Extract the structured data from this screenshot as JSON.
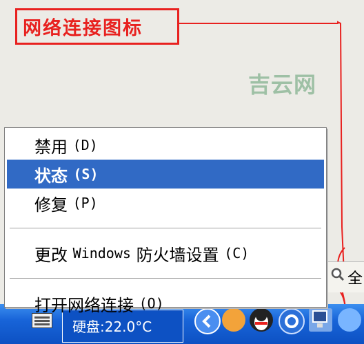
{
  "callout": {
    "label": "网络连接图标"
  },
  "watermark": "吉云网",
  "context_menu": {
    "items": [
      {
        "label": "禁用",
        "hotkey": "(D)"
      },
      {
        "label": "状态",
        "hotkey": "(S)"
      },
      {
        "label": "修复",
        "hotkey": "(P)"
      },
      {
        "label": "更改",
        "latin": "Windows",
        "label_suffix": "防火墙设置",
        "hotkey": "(C)"
      },
      {
        "label": "打开网络连接",
        "hotkey": "(O)"
      }
    ],
    "selected_index": 1
  },
  "taskbar": {
    "disk_status": "硬盘:22.0°C",
    "search_char": "全"
  },
  "colors": {
    "annotation_red": "#e8211f",
    "selection_blue": "#316ac5",
    "taskbar_blue": "#1864d8",
    "watermark_green": "#9ec0a5"
  },
  "icons": [
    "keyboard-icon",
    "back-arrow-icon",
    "qq-penguin-icon",
    "gear-icon",
    "network-connection-icon",
    "search-icon"
  ]
}
